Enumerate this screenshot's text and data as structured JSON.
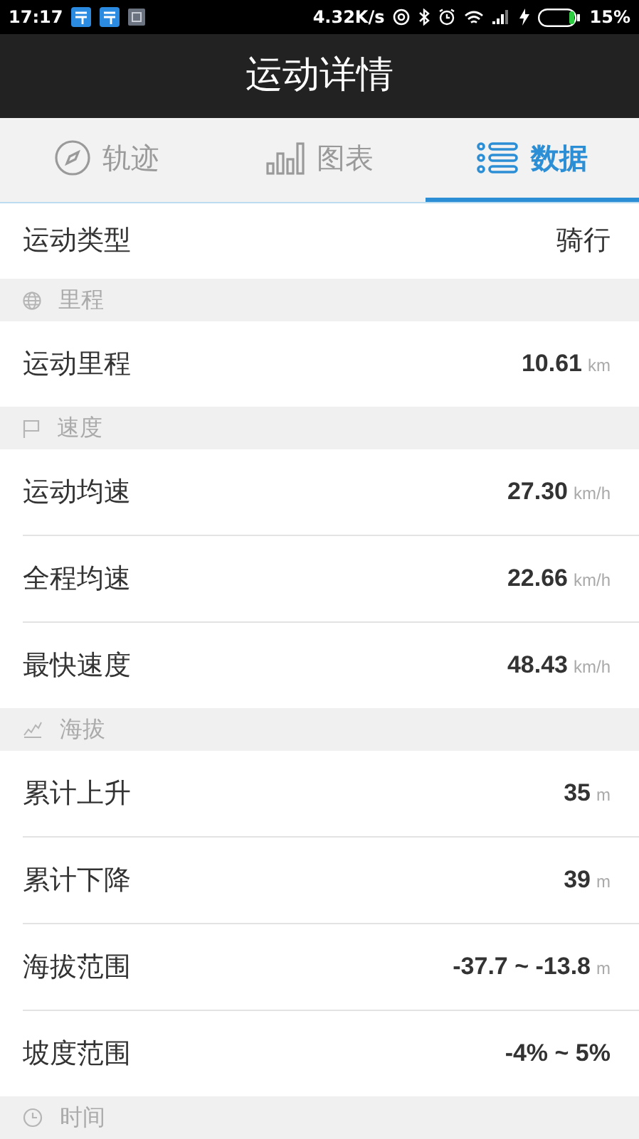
{
  "status_bar": {
    "time": "17:17",
    "speed": "4.32K/s",
    "battery": "15%"
  },
  "header": {
    "title": "运动详情"
  },
  "tabs": [
    {
      "label": "轨迹",
      "kind": "compass",
      "selected": false
    },
    {
      "label": "图表",
      "kind": "bars",
      "selected": false
    },
    {
      "label": "数据",
      "kind": "list",
      "selected": true
    }
  ],
  "type_row": {
    "label": "运动类型",
    "value": "骑行"
  },
  "sections": [
    {
      "title": "里程",
      "kind": "globe",
      "rows": [
        {
          "label": "运动里程",
          "value": "10.61",
          "unit": "km"
        }
      ]
    },
    {
      "title": "速度",
      "kind": "flag",
      "rows": [
        {
          "label": "运动均速",
          "value": "27.30",
          "unit": "km/h"
        },
        {
          "label": "全程均速",
          "value": "22.66",
          "unit": "km/h"
        },
        {
          "label": "最快速度",
          "value": "48.43",
          "unit": "km/h"
        }
      ]
    },
    {
      "title": "海拔",
      "kind": "trend",
      "rows": [
        {
          "label": "累计上升",
          "value": "35",
          "unit": "m"
        },
        {
          "label": "累计下降",
          "value": "39",
          "unit": "m"
        },
        {
          "label": "海拔范围",
          "value": "-37.7 ~ -13.8",
          "unit": "m"
        },
        {
          "label": "坡度范围",
          "value": "-4% ~ 5%"
        }
      ]
    },
    {
      "title": "时间",
      "kind": "clock"
    }
  ]
}
